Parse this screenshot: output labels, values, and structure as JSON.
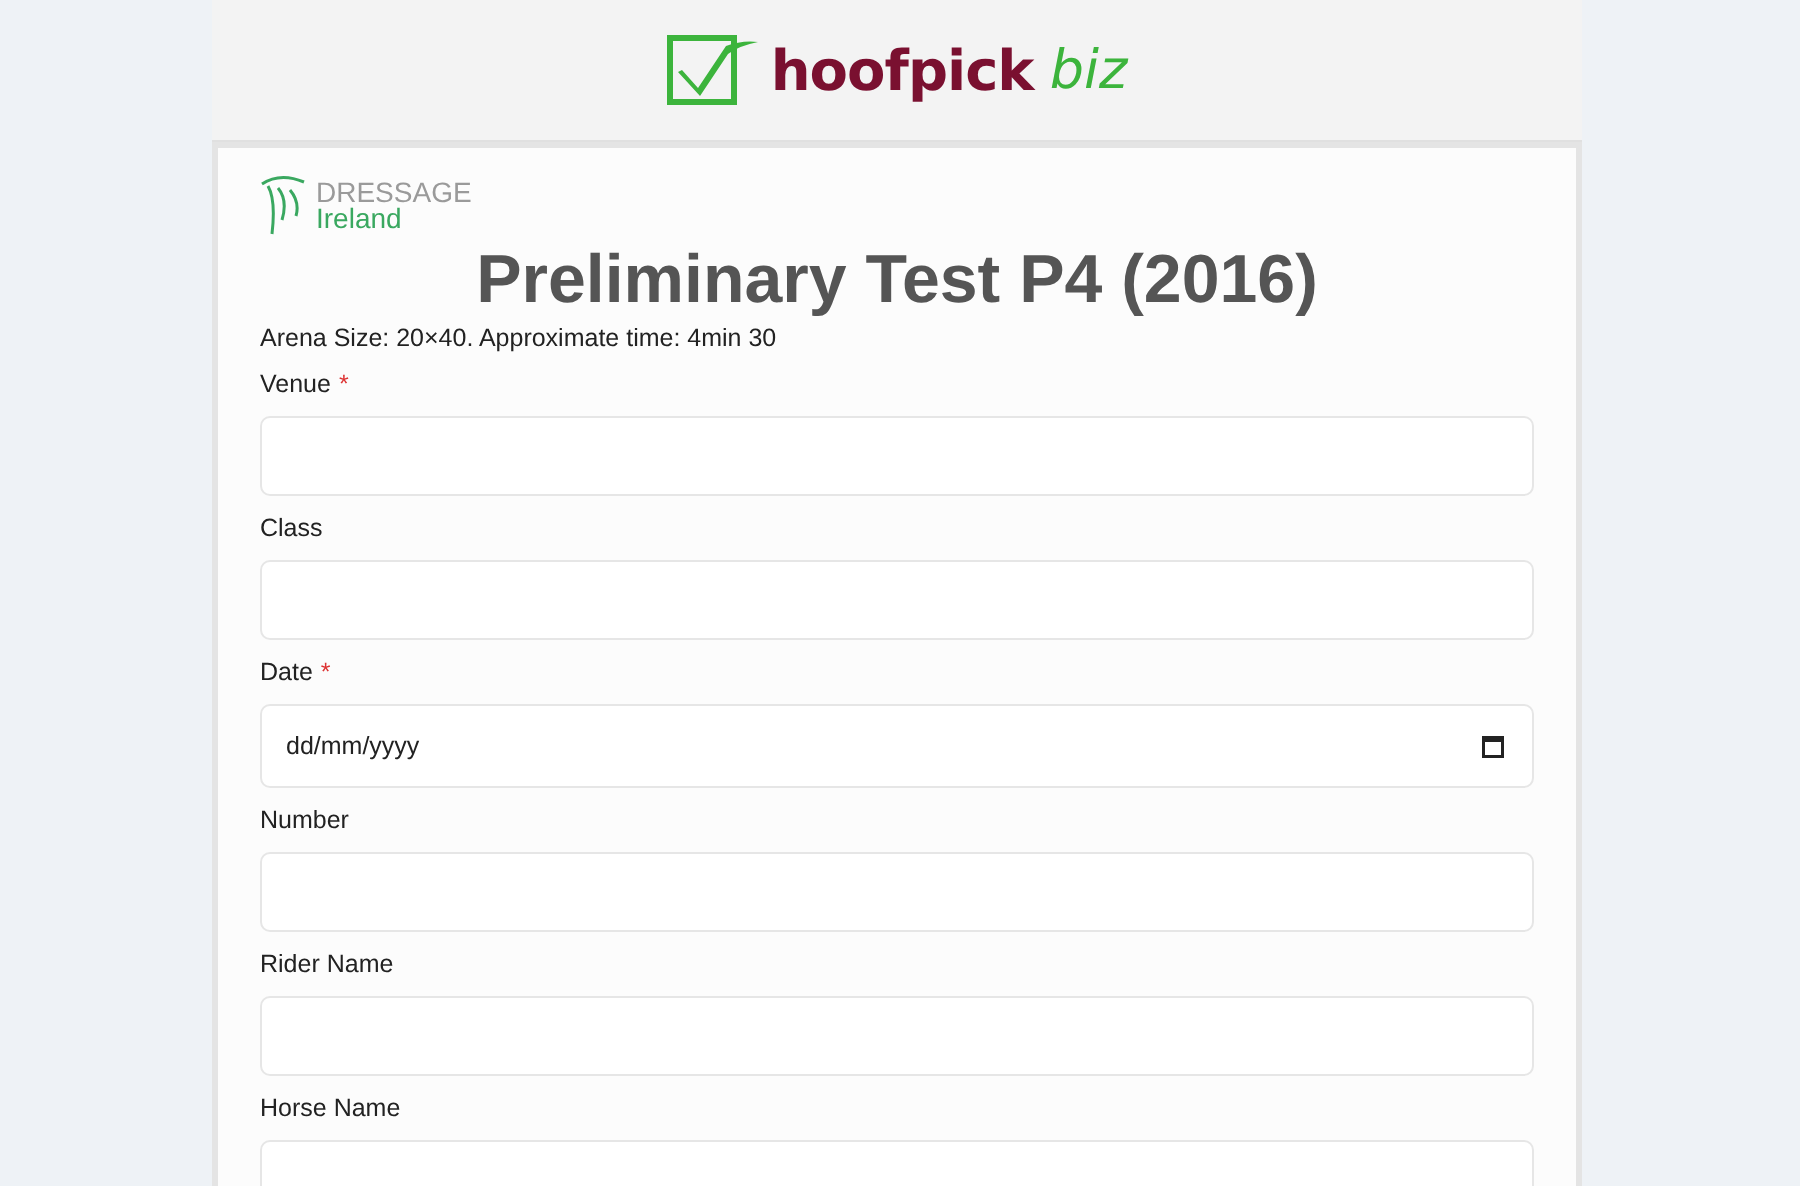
{
  "header": {
    "brand_main": "hoofpick",
    "brand_accent": "biz"
  },
  "org_logo": {
    "line_1": "DRESSAGE",
    "line_2": "Ireland"
  },
  "title": "Preliminary Test P4 (2016)",
  "subtitle": "Arena Size: 20×40. Approximate time: 4min 30",
  "fields": [
    {
      "label": "Venue",
      "required_marker": "*",
      "kind": "text"
    },
    {
      "label": "Class",
      "kind": "text"
    },
    {
      "label": "Date",
      "required_marker": "*",
      "kind": "date",
      "placeholder": "dd/mm/yyyy"
    },
    {
      "label": "Number",
      "kind": "text"
    },
    {
      "label": "Rider Name",
      "kind": "text"
    },
    {
      "label": "Horse Name",
      "kind": "text"
    }
  ]
}
